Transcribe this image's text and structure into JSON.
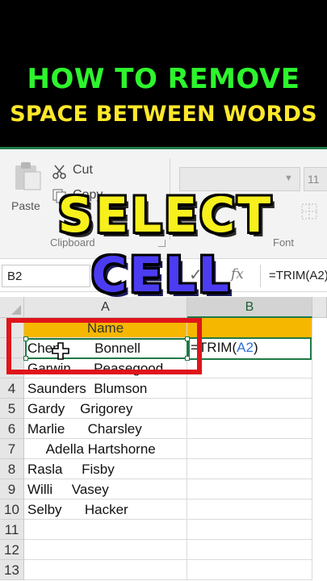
{
  "title": {
    "line1": "HOW TO REMOVE",
    "line2": "SPACE BETWEEN WORDS"
  },
  "overlay": {
    "word1": "SELECT",
    "word2": "CELL"
  },
  "ribbon": {
    "paste_label": "Paste",
    "cut_label": "Cut",
    "copy_label": "Copy",
    "clipboard_group": "Clipboard",
    "font_group": "Font",
    "font_size": "11",
    "font_dropdown_icon": "chevron-down-icon"
  },
  "formula_bar": {
    "name_box": "B2",
    "fx_label": "fx",
    "formula_text": "=TRIM(A2)"
  },
  "grid": {
    "columns": [
      "A",
      "B"
    ],
    "header_cell": "Name",
    "b2_prefix": "=TRIM(",
    "b2_ref": "A2",
    "b2_suffix": ")",
    "rows": [
      {
        "num": "",
        "a": "Chen         Bonnell"
      },
      {
        "num": "",
        "a": "Garwin      Peasegood"
      },
      {
        "num": "4",
        "a": "Saunders  Blumson"
      },
      {
        "num": "5",
        "a": "Gardy    Grigorey"
      },
      {
        "num": "6",
        "a": "Marlie      Charsley"
      },
      {
        "num": "7",
        "a": "     Adella Hartshorne"
      },
      {
        "num": "8",
        "a": "Rasla     Fisby"
      },
      {
        "num": "9",
        "a": "Willi     Vasey"
      },
      {
        "num": "10",
        "a": "Selby      Hacker"
      },
      {
        "num": "11",
        "a": ""
      },
      {
        "num": "12",
        "a": ""
      },
      {
        "num": "13",
        "a": ""
      }
    ]
  },
  "colors": {
    "accent_green": "#1f7a45",
    "highlight_red": "#e0141b",
    "header_fill": "#f6b700"
  }
}
